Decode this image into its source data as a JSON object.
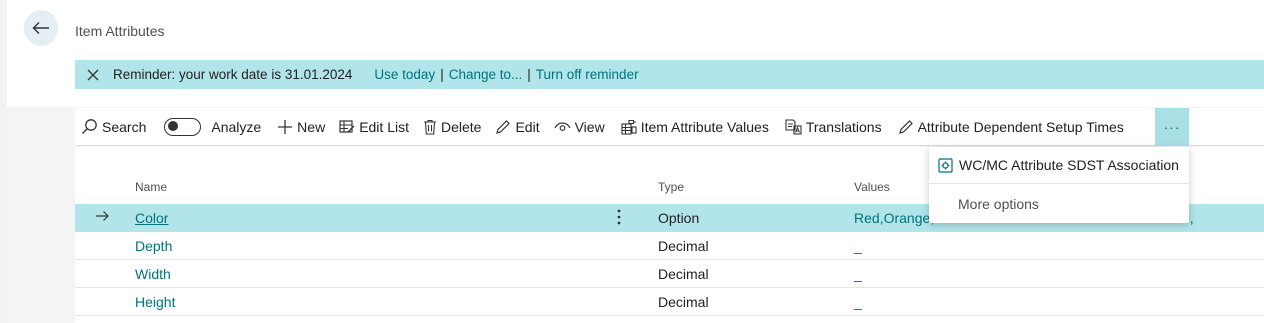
{
  "header": {
    "page_title": "Item Attributes"
  },
  "reminder": {
    "message": "Reminder: your work date is 31.01.2024",
    "link_use_today": "Use today",
    "link_change_to": "Change to...",
    "link_turn_off": "Turn off reminder",
    "separator": "|"
  },
  "toolbar": {
    "search": "Search",
    "analyze": "Analyze",
    "new": "New",
    "edit_list": "Edit List",
    "delete": "Delete",
    "edit": "Edit",
    "view": "View",
    "item_attribute_values": "Item Attribute Values",
    "translations": "Translations",
    "attribute_dependent_setup_times": "Attribute Dependent Setup Times",
    "more": "···"
  },
  "columns": {
    "name": "Name",
    "type": "Type",
    "values": "Values"
  },
  "rows": [
    {
      "name": "Color",
      "type": "Option",
      "values": "Red,Orange,",
      "values_tail": "e,"
    },
    {
      "name": "Depth",
      "type": "Decimal",
      "values": "_"
    },
    {
      "name": "Width",
      "type": "Decimal",
      "values": "_"
    },
    {
      "name": "Height",
      "type": "Decimal",
      "values": "_"
    }
  ],
  "dropdown": {
    "item1": "WC/MC Attribute SDST Association",
    "item2": "More options"
  },
  "colors": {
    "accent": "#00727c",
    "highlight": "#b2e5ea"
  }
}
